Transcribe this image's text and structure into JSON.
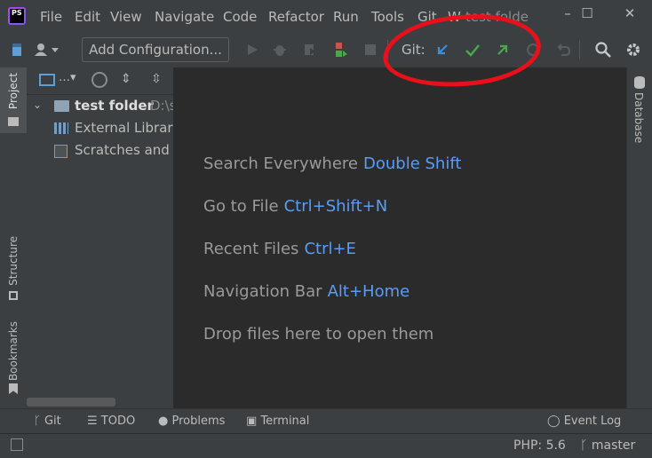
{
  "app": {
    "logo_text": "PS",
    "title_fragment": "test folde"
  },
  "menu": {
    "items": [
      "File",
      "Edit",
      "View",
      "Navigate",
      "Code",
      "Refactor",
      "Run",
      "Tools",
      "Git",
      "W"
    ]
  },
  "window_controls": {
    "minimize": "–",
    "maximize": "☐",
    "close": "✕"
  },
  "toolbar": {
    "add_configuration": "Add Configuration...",
    "git_label": "Git:"
  },
  "project_panel": {
    "tree": [
      {
        "label": "test folder",
        "path": "D:\\s",
        "expanded": true
      },
      {
        "label": "External Librarie"
      },
      {
        "label": "Scratches and C"
      }
    ]
  },
  "left_tabs": {
    "project": "Project",
    "structure": "Structure",
    "bookmarks": "Bookmarks"
  },
  "right_tabs": {
    "database": "Database"
  },
  "editor_hints": [
    {
      "label": "Search Everywhere",
      "shortcut": "Double Shift"
    },
    {
      "label": "Go to File",
      "shortcut": "Ctrl+Shift+N"
    },
    {
      "label": "Recent Files",
      "shortcut": "Ctrl+E"
    },
    {
      "label": "Navigation Bar",
      "shortcut": "Alt+Home"
    },
    {
      "label": "Drop files here to open them",
      "shortcut": ""
    }
  ],
  "bottom_tabs": {
    "git": "Git",
    "todo": "TODO",
    "problems": "Problems",
    "terminal": "Terminal",
    "event_log": "Event Log"
  },
  "status": {
    "php": "PHP: 5.6",
    "branch": "master"
  },
  "colors": {
    "accent": "#589df6",
    "git_update": "#3d8fd8",
    "git_commit": "#4aa84a",
    "git_push": "#4aa84a",
    "annotation": "#e8101a"
  }
}
